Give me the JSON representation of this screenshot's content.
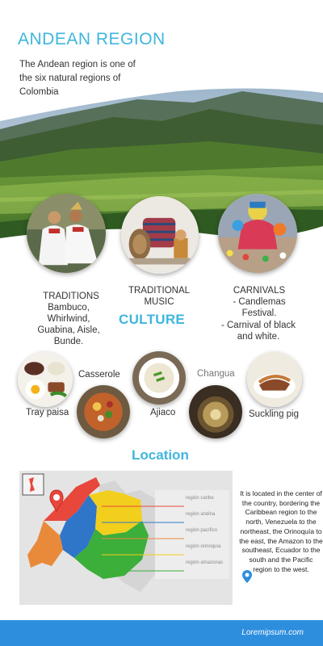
{
  "title": "ANDEAN REGION",
  "intro": "The Andean region is one of the six natural regions of Colombia",
  "culture": {
    "heading": "CULTURE",
    "traditions": {
      "title": "TRADITIONS",
      "text": "Bambuco, Whirlwind, Guabina, Aisle, Bunde."
    },
    "music": {
      "title": "TRADITIONAL MUSIC"
    },
    "carnivals": {
      "title": "CARNIVALS",
      "line1": "- Candlemas Festival.",
      "line2": "- Carnival of black and white."
    }
  },
  "food": {
    "casserole": "Casserole",
    "changua": "Changua",
    "tray_paisa": "Tray paisa",
    "ajiaco": "Ajiaco",
    "suckling_pig": "Suckling pig"
  },
  "location": {
    "heading": "Location",
    "text": "It is located in the center of the country, bordering the Caribbean region to the north, Venezuela to the northeast, the Orinoquía to the east, the Amazon to the southeast, Ecuador to the south and the Pacific region to the west.",
    "legend": [
      {
        "label": "región caribe",
        "color": "#e8473c"
      },
      {
        "label": "región andina",
        "color": "#2f76c9"
      },
      {
        "label": "región pacífico",
        "color": "#e98a3a"
      },
      {
        "label": "región orinoquía",
        "color": "#f2cf1d"
      },
      {
        "label": "región amazonas",
        "color": "#3cae3a"
      }
    ]
  },
  "footer": "Loremipsum.com",
  "colors": {
    "accent": "#3fb6dd",
    "footer": "#2e8ede"
  }
}
